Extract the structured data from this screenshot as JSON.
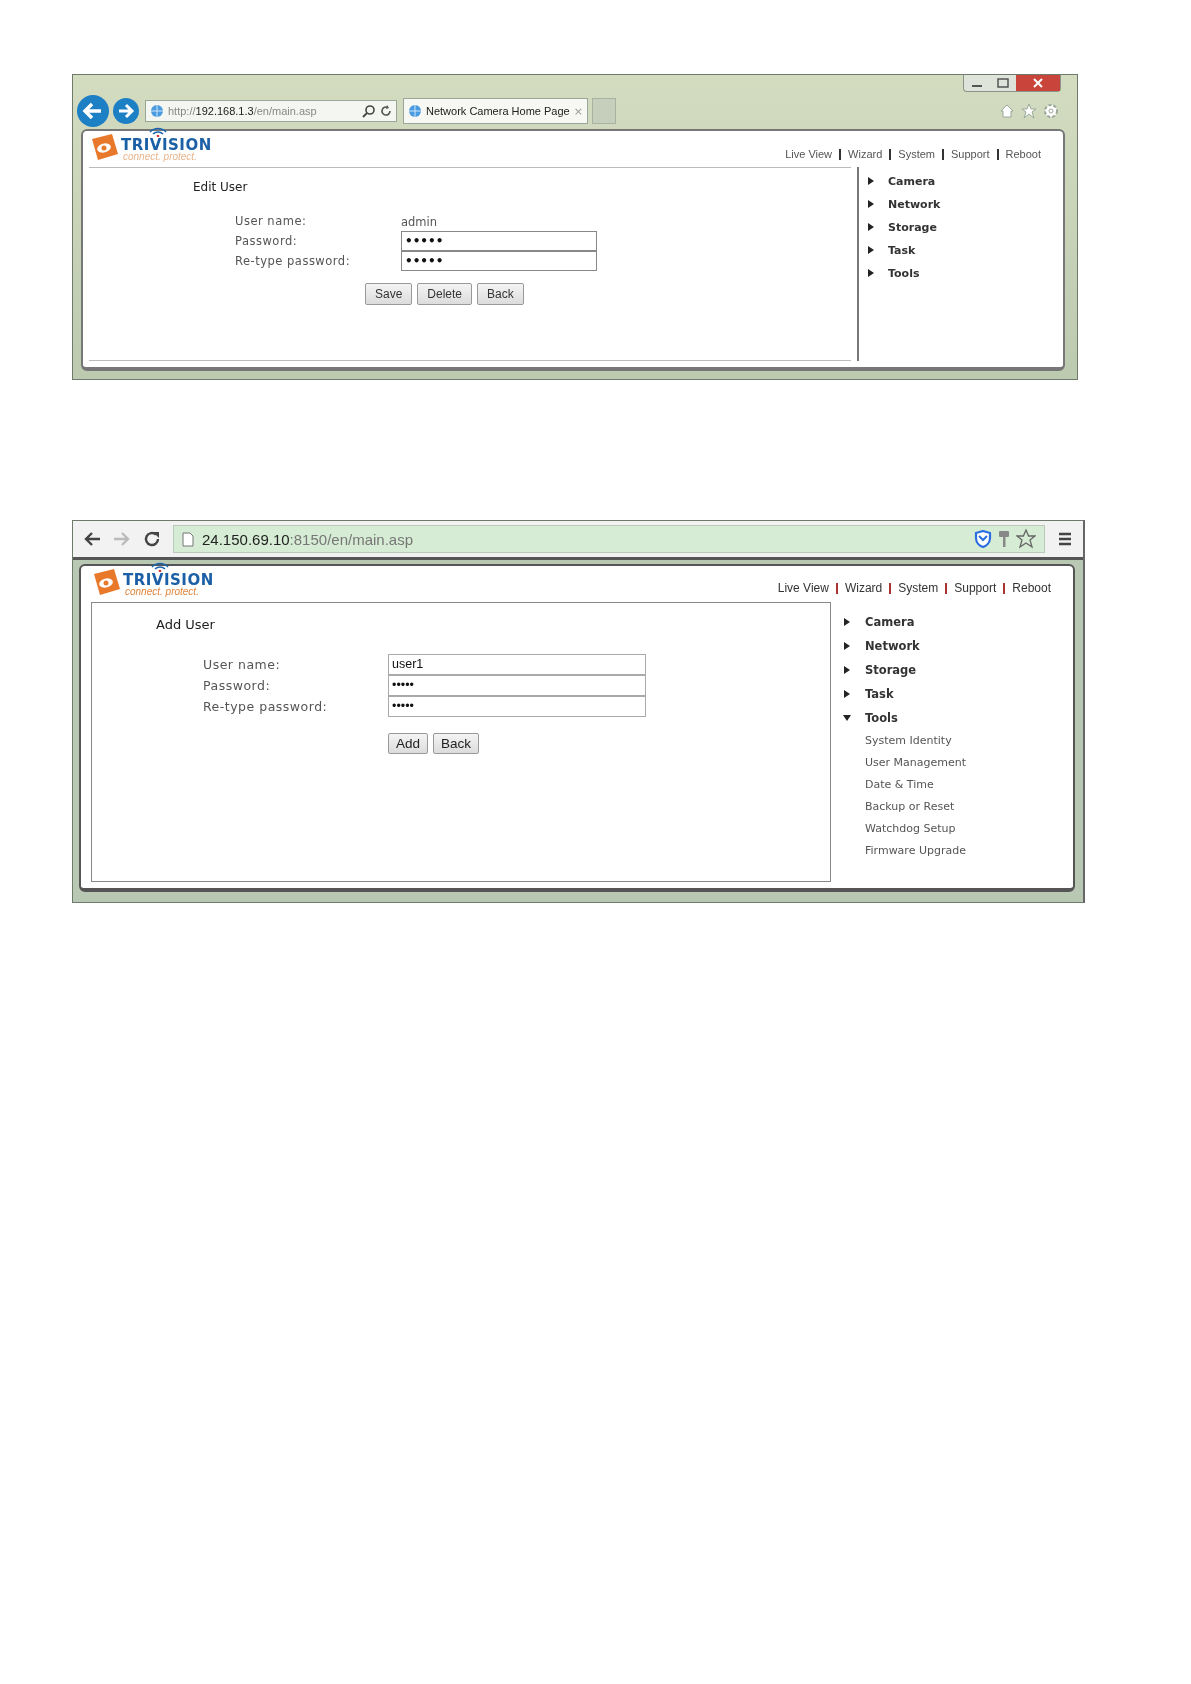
{
  "screenshots": [
    {
      "browser": {
        "kind": "ie",
        "address_parts": [
          {
            "text": "http://",
            "emphasis": false
          },
          {
            "text": "192.168.1.3",
            "emphasis": true
          },
          {
            "text": "/en/main.asp",
            "emphasis": false
          }
        ],
        "tab_title": "Network Camera Home Page",
        "tab_close": "×"
      },
      "logo": {
        "name": "TRIVISION",
        "tagline": "connect. protect."
      },
      "top_nav": [
        "Live View",
        "Wizard",
        "System",
        "Support",
        "Reboot"
      ],
      "form": {
        "title": "Edit User",
        "fields": [
          {
            "label": "User name:",
            "kind": "text",
            "value": "admin"
          },
          {
            "label": "Password:",
            "kind": "input",
            "value": "•••••"
          },
          {
            "label": "Re-type password:",
            "kind": "input",
            "value": "•••••"
          }
        ],
        "buttons": [
          "Save",
          "Delete",
          "Back"
        ]
      },
      "sidebar": [
        {
          "label": "Camera",
          "expanded": false
        },
        {
          "label": "Network",
          "expanded": false
        },
        {
          "label": "Storage",
          "expanded": false
        },
        {
          "label": "Task",
          "expanded": false
        },
        {
          "label": "Tools",
          "expanded": false
        }
      ]
    },
    {
      "browser": {
        "kind": "chrome",
        "address_parts": [
          {
            "text": "24.150.69.10",
            "emphasis": true
          },
          {
            "text": ":8150/en/main.asp",
            "emphasis": false
          }
        ]
      },
      "logo": {
        "name": "TRIVISION",
        "tagline": "connect. protect."
      },
      "top_nav": [
        "Live View",
        "Wizard",
        "System",
        "Support",
        "Reboot"
      ],
      "form": {
        "title": "Add User",
        "fields": [
          {
            "label": "User name:",
            "kind": "input",
            "value": "user1"
          },
          {
            "label": "Password:",
            "kind": "input",
            "value": "•••••"
          },
          {
            "label": "Re-type password:",
            "kind": "input",
            "value": "•••••"
          }
        ],
        "buttons": [
          "Add",
          "Back"
        ]
      },
      "sidebar": [
        {
          "label": "Camera",
          "expanded": false
        },
        {
          "label": "Network",
          "expanded": false
        },
        {
          "label": "Storage",
          "expanded": false
        },
        {
          "label": "Task",
          "expanded": false
        },
        {
          "label": "Tools",
          "expanded": true,
          "children": [
            {
              "label": "System Identity"
            },
            {
              "label": "User Management"
            },
            {
              "label": "Date & Time"
            },
            {
              "label": "Backup or Reset"
            },
            {
              "label": "Watchdog Setup"
            },
            {
              "label": "Firmware Upgrade"
            }
          ]
        }
      ]
    }
  ]
}
